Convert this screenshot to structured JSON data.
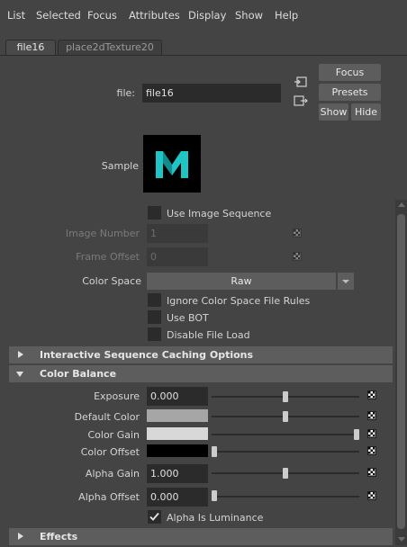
{
  "menu": [
    "List",
    "Selected",
    "Focus",
    "Attributes",
    "Display",
    "Show",
    "Help"
  ],
  "tabs": [
    {
      "label": "file16",
      "active": true
    },
    {
      "label": "place2dTexture20",
      "active": false
    }
  ],
  "header": {
    "file_label": "file:",
    "file_value": "file16",
    "focus_label": "Focus",
    "presets_label": "Presets",
    "show_label": "Show",
    "hide_label": "Hide",
    "sample_label": "Sample",
    "sample_logo": "M"
  },
  "file_attrs": {
    "use_image_sequence": "Use Image Sequence",
    "image_number_label": "Image Number",
    "image_number_value": "1",
    "frame_offset_label": "Frame Offset",
    "frame_offset_value": "0",
    "color_space_label": "Color Space",
    "color_space_value": "Raw",
    "ignore_rules": "Ignore Color Space File Rules",
    "use_bot": "Use BOT",
    "disable_file_load": "Disable File Load"
  },
  "sections": {
    "caching": "Interactive Sequence Caching Options",
    "color_balance": "Color Balance",
    "effects": "Effects"
  },
  "color_balance": {
    "exposure_label": "Exposure",
    "exposure_value": "0.000",
    "exposure_slider": 0.5,
    "default_color_label": "Default Color",
    "default_color_slider": 0.5,
    "color_gain_label": "Color Gain",
    "color_gain_slider": 1.0,
    "color_offset_label": "Color Offset",
    "color_offset_slider": 0.0,
    "alpha_gain_label": "Alpha Gain",
    "alpha_gain_value": "1.000",
    "alpha_gain_slider": 0.5,
    "alpha_offset_label": "Alpha Offset",
    "alpha_offset_value": "0.000",
    "alpha_offset_slider": 0.0,
    "alpha_is_luminance": "Alpha Is Luminance"
  },
  "colors": {
    "background": "#444444",
    "field": "#2b2b2b",
    "button": "#5d5d5d",
    "default_color_swatch": "#a6a6a6",
    "color_gain_swatch": "#d8d8d8",
    "color_offset_swatch": "#000000",
    "logo_cyan": "#1fc4c4"
  }
}
